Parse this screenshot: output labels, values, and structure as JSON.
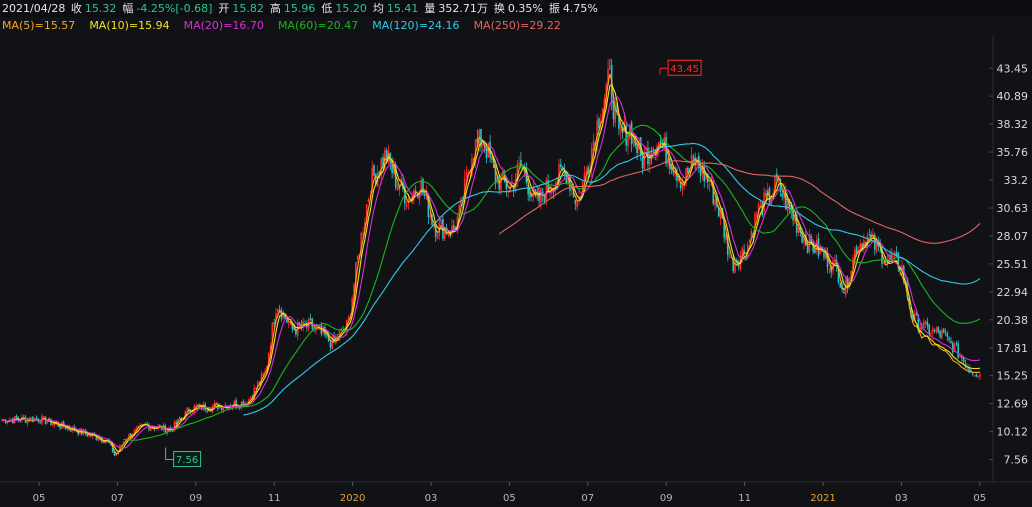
{
  "quote": {
    "date": "2021/04/28",
    "items": [
      {
        "label": "收",
        "value": "15.32",
        "color": "#2fc38a"
      },
      {
        "label": "幅",
        "value": "-4.25%[-0.68]",
        "color": "#2fc38a"
      },
      {
        "label": "开",
        "value": "15.82",
        "color": "#2fc38a"
      },
      {
        "label": "高",
        "value": "15.96",
        "color": "#2fc38a"
      },
      {
        "label": "低",
        "value": "15.20",
        "color": "#2fc38a"
      },
      {
        "label": "均",
        "value": "15.41",
        "color": "#2fc38a"
      },
      {
        "label": "量",
        "value": "352.71万",
        "color": "#e6e6e6"
      },
      {
        "label": "换",
        "value": "0.35%",
        "color": "#e6e6e6"
      },
      {
        "label": "振",
        "value": "4.75%",
        "color": "#e6e6e6"
      }
    ]
  },
  "ma_legend": [
    {
      "text": "MA(5)=15.57",
      "color": "#f5a623"
    },
    {
      "text": "MA(10)=15.94",
      "color": "#f2e21e"
    },
    {
      "text": "MA(20)=16.70",
      "color": "#d92ed6"
    },
    {
      "text": "MA(60)=20.47",
      "color": "#19b61c"
    },
    {
      "text": "MA(120)=24.16",
      "color": "#31c9e8"
    },
    {
      "text": "MA(250)=29.22",
      "color": "#e36464"
    }
  ],
  "chart_data": {
    "type": "candlestick",
    "y_ticks": [
      "43.45",
      "40.89",
      "38.32",
      "35.76",
      "33.2",
      "30.63",
      "28.07",
      "25.51",
      "22.94",
      "20.38",
      "17.81",
      "15.25",
      "12.69",
      "10.12",
      "7.56"
    ],
    "ylim": [
      5.5,
      46.5
    ],
    "x_ticks": [
      {
        "label": "05",
        "highlight": false
      },
      {
        "label": "07",
        "highlight": false
      },
      {
        "label": "09",
        "highlight": false
      },
      {
        "label": "11",
        "highlight": false
      },
      {
        "label": "2020",
        "highlight": true
      },
      {
        "label": "03",
        "highlight": false
      },
      {
        "label": "05",
        "highlight": false
      },
      {
        "label": "07",
        "highlight": false
      },
      {
        "label": "09",
        "highlight": false
      },
      {
        "label": "11",
        "highlight": false
      },
      {
        "label": "2021",
        "highlight": true
      },
      {
        "label": "03",
        "highlight": false
      },
      {
        "label": "05",
        "highlight": false
      }
    ],
    "max_marker": "43.45",
    "min_marker": "7.56",
    "up_color": "#ff2a2a",
    "down_color": "#29c5c6",
    "close_path": [
      {
        "m": 0,
        "v": 11.2
      },
      {
        "m": 1,
        "v": 11.3
      },
      {
        "m": 2,
        "v": 10.2
      },
      {
        "m": 2.8,
        "v": 9.3
      },
      {
        "m": 3,
        "v": 7.9
      },
      {
        "m": 3.3,
        "v": 9.6
      },
      {
        "m": 3.8,
        "v": 10.7
      },
      {
        "m": 4.5,
        "v": 10.3
      },
      {
        "m": 5,
        "v": 12.3
      },
      {
        "m": 5.5,
        "v": 12.4
      },
      {
        "m": 6,
        "v": 12.6
      },
      {
        "m": 6.5,
        "v": 12.8
      },
      {
        "m": 7,
        "v": 15.5
      },
      {
        "m": 7.3,
        "v": 22
      },
      {
        "m": 7.7,
        "v": 19.5
      },
      {
        "m": 8.2,
        "v": 19.8
      },
      {
        "m": 8.8,
        "v": 18.2
      },
      {
        "m": 9.2,
        "v": 20
      },
      {
        "m": 9.5,
        "v": 27
      },
      {
        "m": 9.8,
        "v": 33
      },
      {
        "m": 10.2,
        "v": 35.5
      },
      {
        "m": 10.5,
        "v": 33
      },
      {
        "m": 10.8,
        "v": 31.5
      },
      {
        "m": 11.1,
        "v": 33
      },
      {
        "m": 11.5,
        "v": 29
      },
      {
        "m": 12,
        "v": 28.5
      },
      {
        "m": 12.2,
        "v": 30.5
      },
      {
        "m": 12.5,
        "v": 36
      },
      {
        "m": 12.8,
        "v": 37
      },
      {
        "m": 13.1,
        "v": 33.5
      },
      {
        "m": 13.5,
        "v": 32.5
      },
      {
        "m": 13.8,
        "v": 34.5
      },
      {
        "m": 14.2,
        "v": 31
      },
      {
        "m": 14.6,
        "v": 33
      },
      {
        "m": 15,
        "v": 34
      },
      {
        "m": 15.3,
        "v": 31
      },
      {
        "m": 15.6,
        "v": 35
      },
      {
        "m": 15.9,
        "v": 39.5
      },
      {
        "m": 16.15,
        "v": 42.5
      },
      {
        "m": 16.4,
        "v": 37
      },
      {
        "m": 16.7,
        "v": 38
      },
      {
        "m": 17,
        "v": 35
      },
      {
        "m": 17.4,
        "v": 37
      },
      {
        "m": 17.8,
        "v": 35
      },
      {
        "m": 18.1,
        "v": 33
      },
      {
        "m": 18.4,
        "v": 35
      },
      {
        "m": 18.8,
        "v": 33
      },
      {
        "m": 19.1,
        "v": 30
      },
      {
        "m": 19.4,
        "v": 25.5
      },
      {
        "m": 19.8,
        "v": 27
      },
      {
        "m": 20.1,
        "v": 30.5
      },
      {
        "m": 20.4,
        "v": 31.5
      },
      {
        "m": 20.6,
        "v": 33
      },
      {
        "m": 21,
        "v": 30
      },
      {
        "m": 21.4,
        "v": 27.5
      },
      {
        "m": 21.8,
        "v": 26.5
      },
      {
        "m": 22.2,
        "v": 25
      },
      {
        "m": 22.4,
        "v": 23
      },
      {
        "m": 22.7,
        "v": 27
      },
      {
        "m": 23,
        "v": 28
      },
      {
        "m": 23.5,
        "v": 26
      },
      {
        "m": 23.9,
        "v": 25.5
      },
      {
        "m": 24.2,
        "v": 20.5
      },
      {
        "m": 24.6,
        "v": 19.5
      },
      {
        "m": 25,
        "v": 19
      },
      {
        "m": 25.4,
        "v": 17.5
      },
      {
        "m": 25.7,
        "v": 16
      },
      {
        "m": 26,
        "v": 15.32
      }
    ],
    "ma_lines": [
      {
        "name": "MA(5)",
        "color": "#f5a623",
        "start": 0,
        "smooth": 2
      },
      {
        "name": "MA(10)",
        "color": "#f2e21e",
        "start": 0,
        "smooth": 4
      },
      {
        "name": "MA(20)",
        "color": "#d92ed6",
        "start": 0,
        "smooth": 8
      },
      {
        "name": "MA(60)",
        "color": "#19b61c",
        "start": 3.2,
        "smooth": 28
      },
      {
        "name": "MA(120)",
        "color": "#31c9e8",
        "start": 6.4,
        "smooth": 56
      },
      {
        "name": "MA(250)",
        "color": "#e36464",
        "start": 13.2,
        "smooth": 115
      }
    ],
    "ma_last": [
      15.57,
      15.94,
      16.7,
      20.47,
      24.16,
      29.22
    ]
  }
}
